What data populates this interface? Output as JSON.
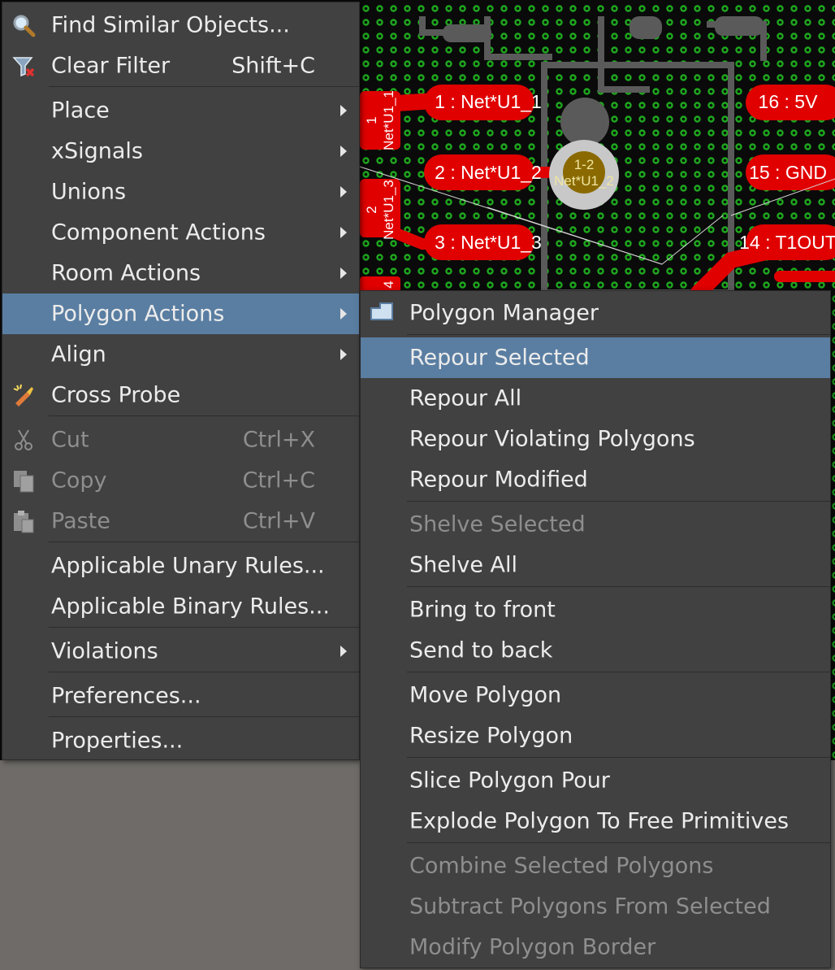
{
  "pcb": {
    "pads": [
      {
        "label": "1 : Net*U1_1"
      },
      {
        "label": "2 : Net*U1_2"
      },
      {
        "label": "3 : Net*U1_3"
      },
      {
        "label": "16 : 5V"
      },
      {
        "label": "15 : GND"
      },
      {
        "label": "14 : T1OUT"
      }
    ],
    "via": {
      "line1": "1-2",
      "line2": "Net*U1_2"
    },
    "side_pads": [
      {
        "line1": "1",
        "line2": "Net*U1_1"
      },
      {
        "line1": "2",
        "line2": "Net*U1_3"
      },
      {
        "line1": "4",
        "line2": ""
      }
    ]
  },
  "main_menu": {
    "items": [
      {
        "label": "Find Similar Objects...",
        "shortcut": "",
        "submenu": false,
        "icon": "magnifier-icon"
      },
      {
        "label": "Clear Filter",
        "shortcut": "Shift+C",
        "submenu": false,
        "icon": "clear-filter-icon"
      },
      {
        "label": "Place",
        "shortcut": "",
        "submenu": true
      },
      {
        "label": "xSignals",
        "shortcut": "",
        "submenu": true
      },
      {
        "label": "Unions",
        "shortcut": "",
        "submenu": true
      },
      {
        "label": "Component Actions",
        "shortcut": "",
        "submenu": true
      },
      {
        "label": "Room Actions",
        "shortcut": "",
        "submenu": true
      },
      {
        "label": "Polygon Actions",
        "shortcut": "",
        "submenu": true,
        "highlighted": true
      },
      {
        "label": "Align",
        "shortcut": "",
        "submenu": true
      },
      {
        "label": "Cross Probe",
        "shortcut": "",
        "submenu": false,
        "icon": "cross-probe-icon"
      },
      {
        "label": "Cut",
        "shortcut": "Ctrl+X",
        "submenu": false,
        "disabled": true,
        "icon": "scissors-icon"
      },
      {
        "label": "Copy",
        "shortcut": "Ctrl+C",
        "submenu": false,
        "disabled": true,
        "icon": "copy-icon"
      },
      {
        "label": "Paste",
        "shortcut": "Ctrl+V",
        "submenu": false,
        "disabled": true,
        "icon": "paste-icon"
      },
      {
        "label": "Applicable Unary Rules...",
        "shortcut": "",
        "submenu": false
      },
      {
        "label": "Applicable Binary Rules...",
        "shortcut": "",
        "submenu": false
      },
      {
        "label": "Violations",
        "shortcut": "",
        "submenu": true
      },
      {
        "label": "Preferences...",
        "shortcut": "",
        "submenu": false
      },
      {
        "label": "Properties...",
        "shortcut": "",
        "submenu": false
      }
    ]
  },
  "polygon_submenu": {
    "items": [
      {
        "label": "Polygon Manager",
        "icon": "polygon-manager-icon"
      },
      {
        "label": "Repour Selected",
        "highlighted": true
      },
      {
        "label": "Repour All"
      },
      {
        "label": "Repour Violating Polygons"
      },
      {
        "label": "Repour Modified"
      },
      {
        "label": "Shelve Selected",
        "disabled": true
      },
      {
        "label": "Shelve All"
      },
      {
        "label": "Bring to front"
      },
      {
        "label": "Send to back"
      },
      {
        "label": "Move Polygon"
      },
      {
        "label": "Resize Polygon"
      },
      {
        "label": "Slice Polygon Pour"
      },
      {
        "label": "Explode Polygon To Free Primitives"
      },
      {
        "label": "Combine Selected Polygons",
        "disabled": true
      },
      {
        "label": "Subtract Polygons From Selected",
        "disabled": true
      },
      {
        "label": "Modify Polygon Border",
        "disabled": true
      }
    ]
  },
  "colors": {
    "menu_bg": "#414141",
    "highlight": "#5a7ea2",
    "pad_red": "#e00000",
    "board_bg": "#0a0a0a",
    "via_grid": "#1ea81e"
  }
}
